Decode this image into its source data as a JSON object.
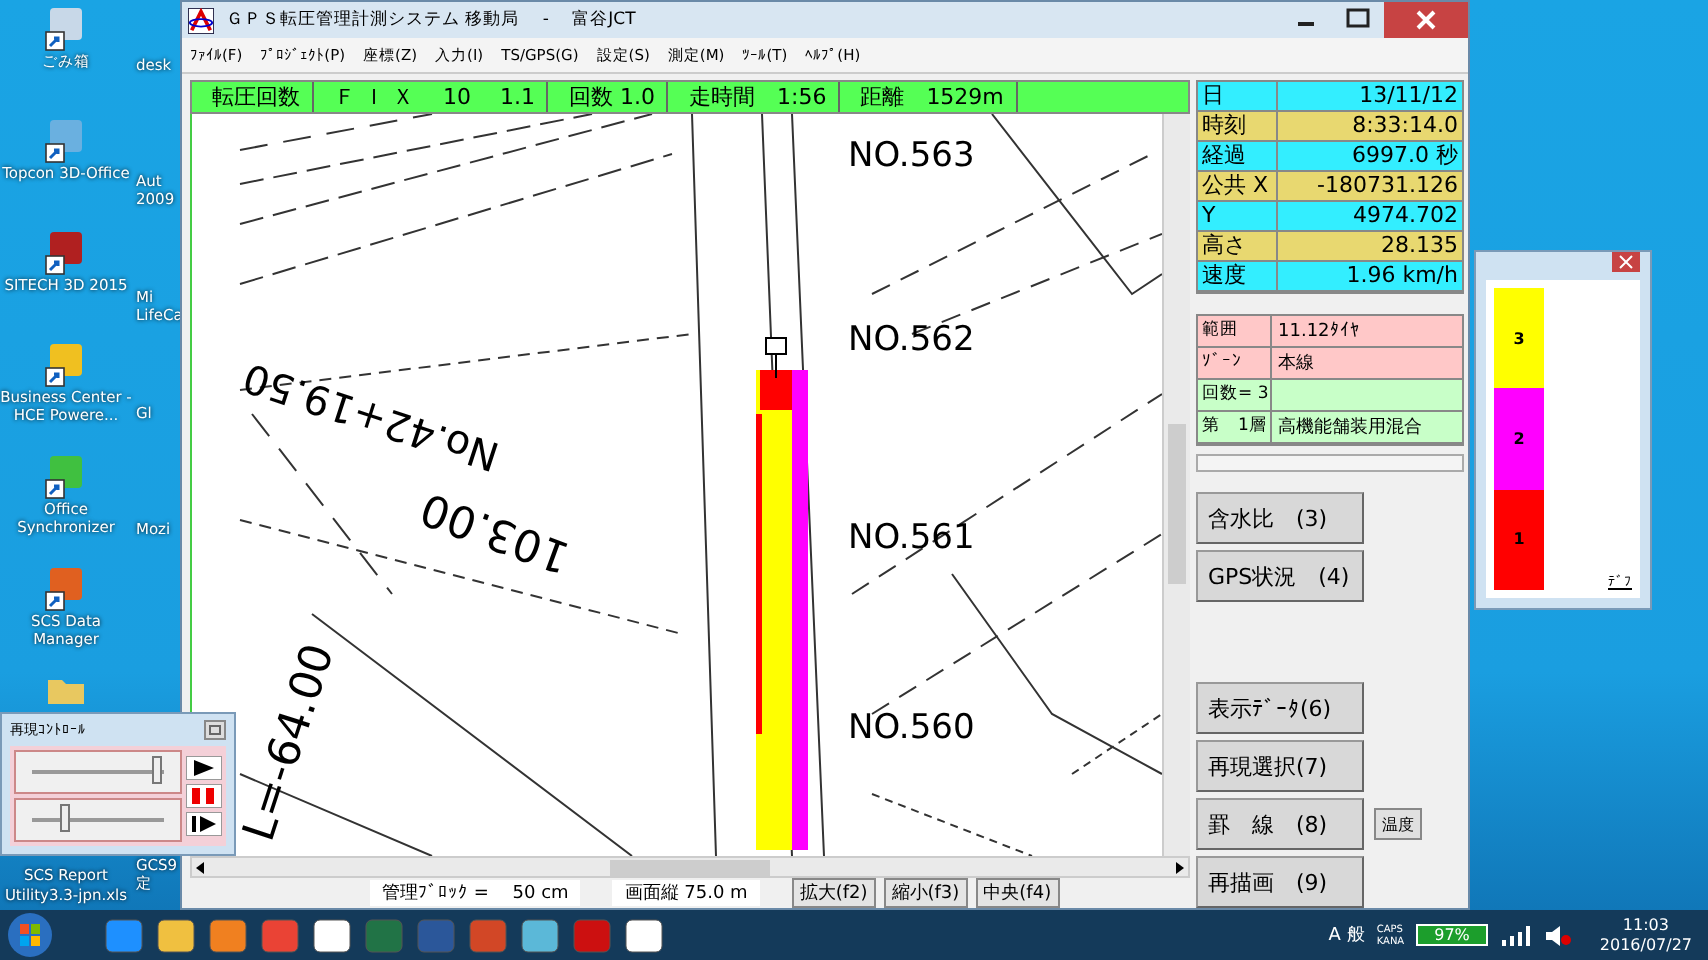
{
  "desktop_icons": [
    {
      "label": "ごみ箱"
    },
    {
      "label": "Topcon 3D-Office"
    },
    {
      "label": "SITECH 3D 2015"
    },
    {
      "label": "Business Center - HCE Powere..."
    },
    {
      "label": "Office Synchronizer"
    },
    {
      "label": "SCS Data Manager"
    },
    {
      "label": "SCS Report Utility3.3-jpn.xls",
      "kind": "file"
    }
  ],
  "desktop_icons_column_2": [
    {
      "label": "desk"
    },
    {
      "label": "Aut 2009"
    },
    {
      "label": "Mi LifeCa"
    },
    {
      "label": "Gl"
    },
    {
      "label": "Mozi"
    },
    {
      "label": "GCS9 定"
    }
  ],
  "window": {
    "title": "ＧＰＳ転圧管理計測システム 移動局　 -　 富谷JCT",
    "menu": [
      "ﾌｧｲﾙ(F)",
      "ﾌﾟﾛｼﾞｪｸﾄ(P)",
      "座標(Z)",
      "入力(I)",
      "TS/GPS(G)",
      "設定(S)",
      "測定(M)",
      "ﾂｰﾙ(T)",
      "ﾍﾙﾌﾟ(H)"
    ]
  },
  "status_header": [
    "転圧回数",
    "Ｆ Ｉ Ｘ　 10　 1.1",
    "回数 1.0",
    "走時間　1:56",
    "距離　1529m"
  ],
  "map": {
    "labels": [
      {
        "text": "NO.563",
        "kind": "station"
      },
      {
        "text": "NO.562",
        "kind": "station"
      },
      {
        "text": "NO.561",
        "kind": "station"
      },
      {
        "text": "NO.560",
        "kind": "station"
      },
      {
        "text": "No.42+19.50",
        "kind": "chainage"
      },
      {
        "text": "103.00",
        "kind": "radius"
      },
      {
        "text": "L=-64.00",
        "kind": "length"
      }
    ]
  },
  "info_table": [
    {
      "label": "日",
      "value": "13/11/12"
    },
    {
      "label": "時刻",
      "value": "8:33:14.0"
    },
    {
      "label": "経過",
      "value": "6997.0 秒"
    },
    {
      "label": "公共 X",
      "value": "-180731.126"
    },
    {
      "label": "Y",
      "value": "4974.702"
    },
    {
      "label": "高さ",
      "value": "28.135"
    },
    {
      "label": "速度",
      "value": "1.96 km/h"
    }
  ],
  "range_table": [
    {
      "label": "範囲",
      "value": "11.12ﾀｲﾔ",
      "color": "#ffc8c8"
    },
    {
      "label": "ｿﾞｰﾝ",
      "value": "本線",
      "color": "#ffc8c8"
    },
    {
      "label": "回数= 3",
      "color": "#c8ffc8"
    },
    {
      "label": "第　1層",
      "value": "高機能舗装用混合",
      "color": "#c8ffc8"
    }
  ],
  "buttons_top": [
    "含水比　(3)",
    "GPS状況　(4)"
  ],
  "buttons_bottom": [
    "表示ﾃﾞｰﾀ(6)",
    "再現選択(7)",
    "罫　線　(8)",
    "再描画　(9)"
  ],
  "temperature_button": "温度",
  "status_bar": {
    "block": "管理ﾌﾞﾛｯｸ =　 50 cm",
    "screen": "画面縦 75.0 m",
    "buttons": [
      "拡大(f2)",
      "縮小(f3)",
      "中央(f4)"
    ]
  },
  "legend_window": {
    "layers": [
      {
        "label": "3",
        "color": "#ffff00"
      },
      {
        "label": "2",
        "color": "#ff00ff"
      },
      {
        "label": "1",
        "color": "#ff0000"
      }
    ],
    "caption": "ﾃﾞﾌ"
  },
  "playback_window": {
    "title": "再現ｺﾝﾄﾛｰﾙ",
    "sliders": [
      {
        "level": 0.95
      },
      {
        "level": 0.25
      }
    ]
  },
  "taskbar": {
    "ime": "A 般",
    "caps": "CAPS",
    "kana": "KANA",
    "battery": "97%",
    "time": "11:03",
    "date": "2016/07/27"
  }
}
